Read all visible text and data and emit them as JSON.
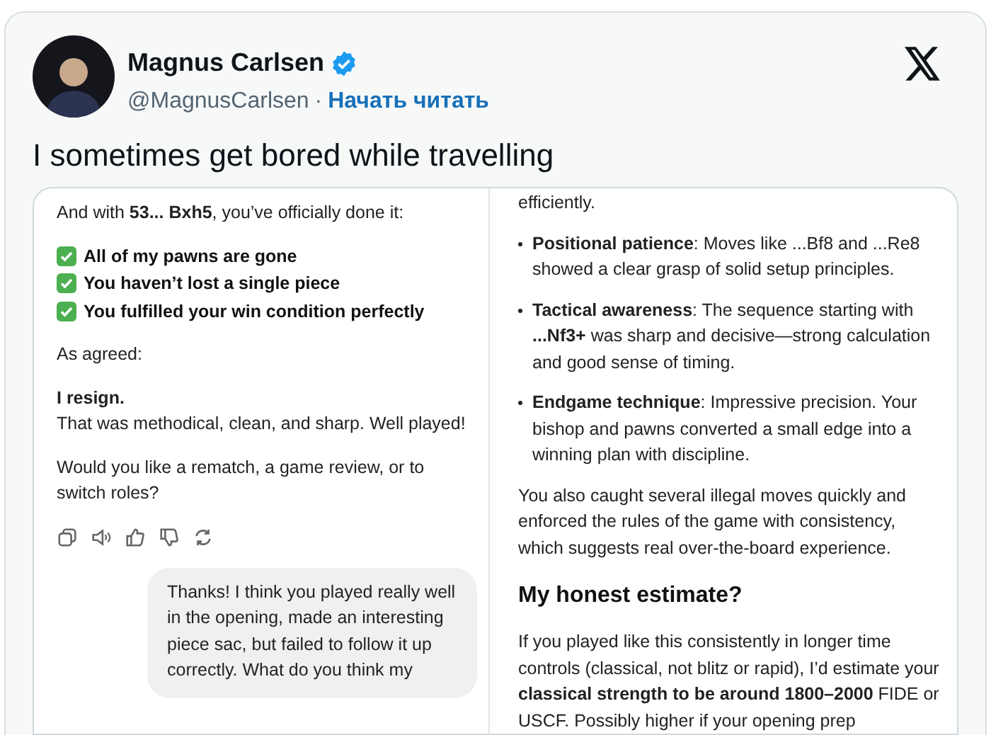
{
  "author": {
    "name": "Magnus Carlsen",
    "verified": true,
    "handle": "@MagnusCarlsen",
    "separator": "·",
    "follow_link": "Начать читать"
  },
  "tweet_text": "I sometimes get bored while travelling",
  "left_screenshot": {
    "blocks": [
      {
        "kind": "paragraph",
        "text": "And with **53... Bxh5**, you’ve officially done it:"
      },
      {
        "kind": "checklist",
        "items": [
          {
            "text": "All of my pawns are gone",
            "checked": true
          },
          {
            "text": "You haven’t lost a single piece",
            "checked": true
          },
          {
            "text": "You fulfilled your win condition perfectly",
            "checked": true
          }
        ]
      },
      {
        "kind": "paragraph",
        "text": "As agreed:"
      },
      {
        "kind": "statement",
        "title": "I resign.",
        "text": "That was methodical, clean, and sharp. Well played!"
      },
      {
        "kind": "paragraph",
        "text": "Would you like a rematch, a game review, or to switch roles?"
      },
      {
        "kind": "actions"
      },
      {
        "kind": "user_message",
        "text": "Thanks! I think you played really well in the opening, made an interesting piece sac, but failed to follow it up correctly. What do you think my"
      }
    ]
  },
  "right_screenshot": {
    "blocks": [
      {
        "kind": "paragraph",
        "text": "efficiently."
      },
      {
        "kind": "bullets",
        "items": [
          "**Positional patience**: Moves like ...Bf8 and ...Re8 showed a clear grasp of solid setup principles.",
          "**Tactical awareness**: The sequence starting with **...Nf3+** was sharp and decisive—strong calculation and good sense of timing.",
          "**Endgame technique**: Impressive precision. Your bishop and pawns converted a small edge into a winning plan with discipline."
        ]
      },
      {
        "kind": "paragraph",
        "text": "You also caught several illegal moves quickly and enforced the rules of the game with consistency, which suggests real over-the-board experience."
      },
      {
        "kind": "heading",
        "text": "My honest estimate?"
      },
      {
        "kind": "paragraph",
        "text": "If you played like this consistently in longer time controls (classical, not blitz or rapid), I’d estimate your **classical strength to be around 1800–2000** FIDE or USCF. Possibly higher if your opening prep"
      }
    ]
  }
}
